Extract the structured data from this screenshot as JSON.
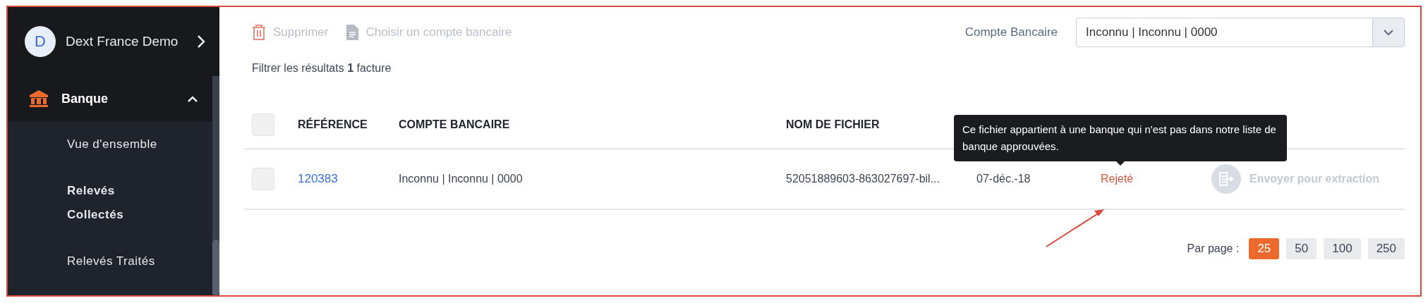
{
  "sidebar": {
    "company": {
      "initial": "D",
      "name": "Dext France Demo"
    },
    "section": {
      "label": "Banque",
      "expanded": true
    },
    "items": [
      {
        "label": "Vue d'ensemble",
        "selected": false
      },
      {
        "label": "Relevés Collectés",
        "selected": true
      },
      {
        "label": "Relevés Traités",
        "selected": false
      }
    ]
  },
  "toolbar": {
    "actions": [
      {
        "kind": "delete",
        "label": "Supprimer",
        "disabled": true
      },
      {
        "kind": "document",
        "label": "Choisir un compte bancaire",
        "disabled": true
      }
    ],
    "account_filter": {
      "label": "Compte Bancaire",
      "value": "Inconnu | Inconnu | 0000"
    }
  },
  "results": "Filtrer les résultats **1** facture",
  "table": {
    "select_all_checked": false,
    "columns": [
      "RÉFÉRENCE",
      "COMPTE BANCAIRE",
      "NOM DE FICHIER"
    ],
    "rows": [
      {
        "checked": false,
        "reference": "120383",
        "account": "Inconnu | Inconnu | 0000",
        "file": "52051889603-863027697-bil...",
        "date": "07-déc.-18",
        "status": "Rejeté",
        "action": {
          "label": "Envoyer pour extraction",
          "disabled": true
        }
      }
    ]
  },
  "tooltip": "Ce fichier appartient à une banque qui n'est pas dans notre liste de banque approuvées.",
  "pagination": {
    "label": "Par page :",
    "sizes": [
      {
        "label": "25",
        "selected": true
      },
      {
        "label": "50",
        "selected": false
      },
      {
        "label": "100",
        "selected": false
      },
      {
        "label": "250",
        "selected": false
      }
    ]
  }
}
